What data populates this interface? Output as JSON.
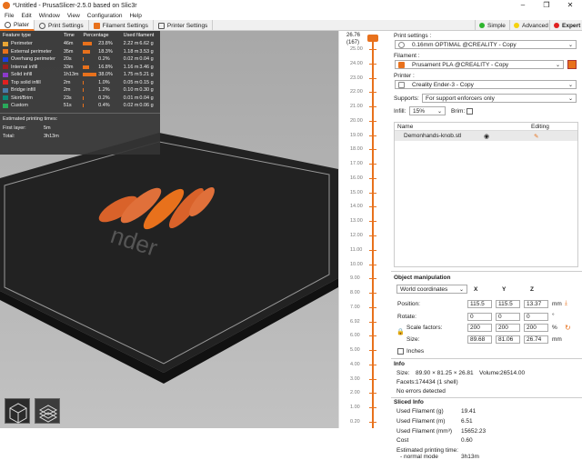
{
  "window": {
    "title": "*Untitled - PrusaSlicer-2.5.0 based on Slic3r"
  },
  "menu": [
    "File",
    "Edit",
    "Window",
    "View",
    "Configuration",
    "Help"
  ],
  "tabs": [
    "Plater",
    "Print Settings",
    "Filament Settings",
    "Printer Settings"
  ],
  "modes": [
    {
      "label": "Simple",
      "color": "#2db52d"
    },
    {
      "label": "Advanced",
      "color": "#f5d20e"
    },
    {
      "label": "Expert",
      "color": "#e02020"
    }
  ],
  "stats": {
    "headers": [
      "Feature type",
      "Time",
      "Percentage",
      "Used filament"
    ],
    "rows": [
      {
        "name": "Perimeter",
        "time": "46m",
        "pct": "23.8%",
        "frac": 0.238,
        "len": "2.22 m",
        "wt": "6.62 g",
        "color": "#e8a535"
      },
      {
        "name": "External perimeter",
        "time": "35m",
        "pct": "18.3%",
        "frac": 0.183,
        "len": "1.18 m",
        "wt": "3.53 g",
        "color": "#e8711c"
      },
      {
        "name": "Overhang perimeter",
        "time": "20s",
        "pct": "0.2%",
        "frac": 0.002,
        "len": "0.02 m",
        "wt": "0.04 g",
        "color": "#1a3fe0"
      },
      {
        "name": "Internal infill",
        "time": "33m",
        "pct": "16.8%",
        "frac": 0.168,
        "len": "1.16 m",
        "wt": "3.46 g",
        "color": "#9b1e1e"
      },
      {
        "name": "Solid infill",
        "time": "1h13m",
        "pct": "38.0%",
        "frac": 0.38,
        "len": "1.75 m",
        "wt": "5.21 g",
        "color": "#8b3ac9"
      },
      {
        "name": "Top solid infill",
        "time": "2m",
        "pct": "1.0%",
        "frac": 0.01,
        "len": "0.05 m",
        "wt": "0.15 g",
        "color": "#e02020"
      },
      {
        "name": "Bridge infill",
        "time": "2m",
        "pct": "1.2%",
        "frac": 0.012,
        "len": "0.10 m",
        "wt": "0.30 g",
        "color": "#4a7ba8"
      },
      {
        "name": "Skirt/Brim",
        "time": "23s",
        "pct": "0.2%",
        "frac": 0.002,
        "len": "0.01 m",
        "wt": "0.04 g",
        "color": "#0a8a7a"
      },
      {
        "name": "Custom",
        "time": "51s",
        "pct": "0.4%",
        "frac": 0.004,
        "len": "0.02 m",
        "wt": "0.06 g",
        "color": "#2aa85a"
      }
    ],
    "est_title": "Estimated printing times:",
    "first_layer_label": "First layer:",
    "first_layer": "5m",
    "total_label": "Total:",
    "total": "3h13m"
  },
  "ruler": {
    "top": "26.76",
    "top_layer": "(167)",
    "ticks": [
      "25.00",
      "24.00",
      "23.00",
      "22.00",
      "21.00",
      "20.00",
      "19.00",
      "18.00",
      "17.00",
      "16.00",
      "15.00",
      "14.00",
      "13.00",
      "12.00",
      "11.00",
      "10.00",
      "9.00",
      "8.00",
      "7.00",
      "6.92",
      "6.00",
      "5.00",
      "4.00",
      "3.00",
      "2.00",
      "1.00",
      "0.20"
    ]
  },
  "panel": {
    "print_settings_label": "Print settings :",
    "print_settings": "0.16mm OPTIMAL @CREALITY - Copy",
    "filament_label": "Filament :",
    "filament": "Prusament PLA @CREALITY - Copy",
    "filament_color": "#e8711c",
    "printer_label": "Printer :",
    "printer": "Creality Ender-3 - Copy",
    "supports_label": "Supports:",
    "supports": "For support enforcers only",
    "infill_label": "Infill:",
    "infill": "15%",
    "brim_label": "Brim:",
    "list_name": "Name",
    "list_editing": "Editing",
    "object_name": "Demonhands-knob.stl",
    "om_title": "Object manipulation",
    "coords": "World coordinates",
    "axes": [
      "X",
      "Y",
      "Z"
    ],
    "position_label": "Position:",
    "position": [
      "115.5",
      "115.5",
      "13.37"
    ],
    "position_unit": "mm",
    "rotate_label": "Rotate:",
    "rotate": [
      "0",
      "0",
      "0"
    ],
    "rotate_unit": "°",
    "scale_label": "Scale factors:",
    "scale": [
      "200",
      "200",
      "200"
    ],
    "scale_unit": "%",
    "size_label": "Size:",
    "size": [
      "89.68",
      "81.06",
      "26.74"
    ],
    "size_unit": "mm",
    "inches_label": "Inches",
    "info_title": "Info",
    "info_size_label": "Size:",
    "info_size": "89.90 × 81.25 × 26.81",
    "volume_label": "Volume:",
    "volume": "26514.00",
    "facets_label": "Facets:",
    "facets": "174434 (1 shell)",
    "no_errors": "No errors detected",
    "sliced_title": "Sliced Info",
    "used_g_label": "Used Filament (g)",
    "used_g": "19.41",
    "used_m_label": "Used Filament (m)",
    "used_m": "6.51",
    "used_mm3_label": "Used Filament (mm³)",
    "used_mm3": "15652.23",
    "cost_label": "Cost",
    "cost": "0.60",
    "est_label": "Estimated printing time:",
    "normal_label": "- normal mode",
    "normal": "3h13m"
  },
  "bed_text": "nder"
}
